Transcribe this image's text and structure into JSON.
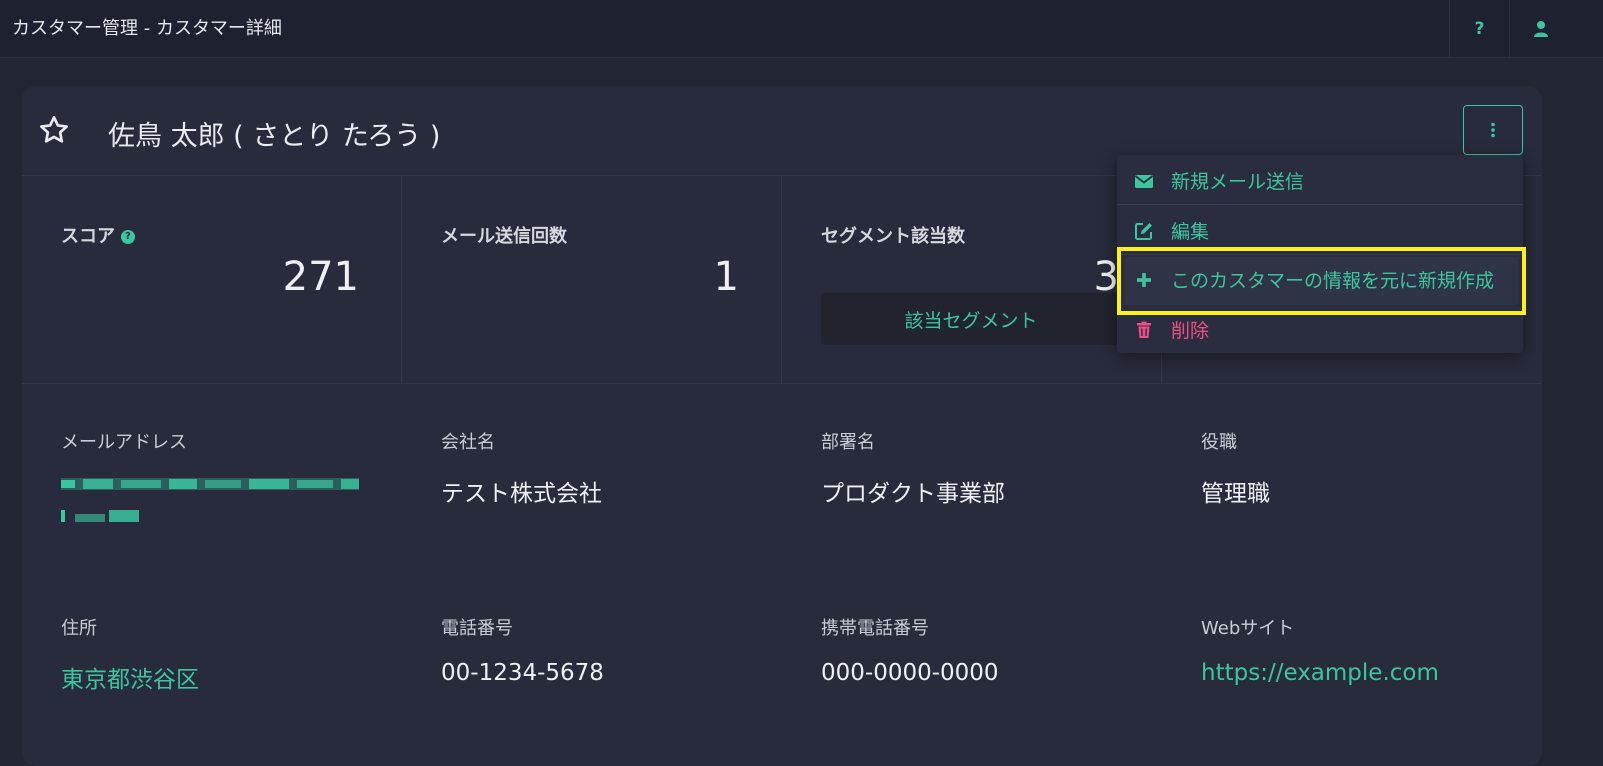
{
  "topbar": {
    "title": "カスタマー管理 - カスタマー詳細",
    "help_label": "?"
  },
  "customer": {
    "name": "佐鳥 太郎 ( さとり たろう )"
  },
  "stats": [
    {
      "label": "スコア",
      "value": "271"
    },
    {
      "label": "メール送信回数",
      "value": "1"
    },
    {
      "label": "セグメント該当数",
      "value": "3",
      "button_label": "該当セグメント"
    }
  ],
  "fields": {
    "email_label": "メールアドレス",
    "company_label": "会社名",
    "company_value": "テスト株式会社",
    "department_label": "部署名",
    "department_value": "プロダクト事業部",
    "position_label": "役職",
    "position_value": "管理職",
    "address_label": "住所",
    "address_value": "東京都渋谷区",
    "phone_label": "電話番号",
    "phone_value": "00-1234-5678",
    "mobile_label": "携帯電話番号",
    "mobile_value": "000-0000-0000",
    "website_label": "Webサイト",
    "website_value": "https://example.com"
  },
  "menu": {
    "items": [
      {
        "label": "新規メール送信",
        "icon": "envelope-icon"
      },
      {
        "label": "編集",
        "icon": "edit-icon"
      },
      {
        "label": "このカスタマーの情報を元に新規作成",
        "icon": "plus-icon"
      },
      {
        "label": "削除",
        "icon": "trash-icon"
      }
    ]
  },
  "colors": {
    "accent": "#3cc6a0",
    "danger": "#ef4f86",
    "highlight": "#fbf21a",
    "background": "#222533",
    "card": "#282b3c"
  }
}
